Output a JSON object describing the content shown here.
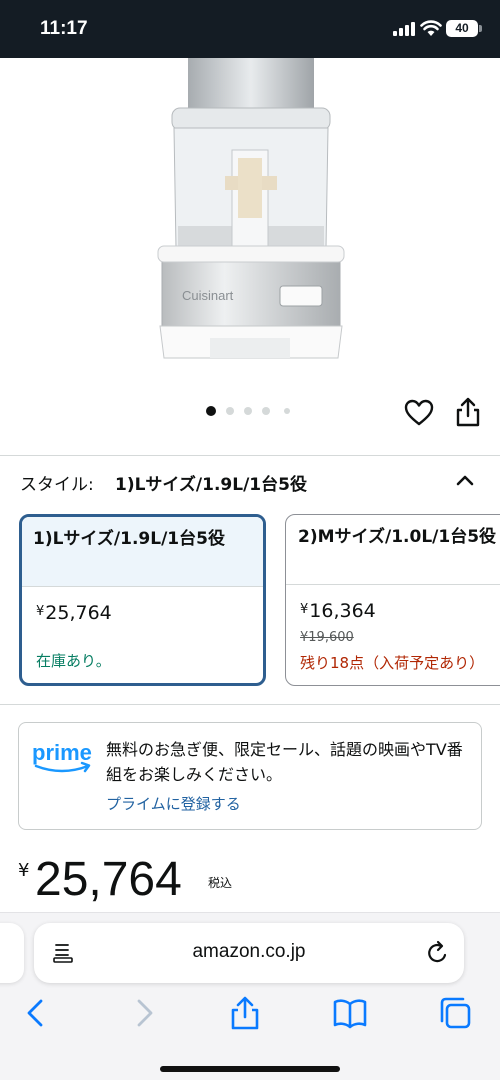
{
  "status_bar": {
    "time": "11:17",
    "battery": "40"
  },
  "product": {
    "image_brand": "Cuisinart",
    "image_caption": "FOOD PROCESSOR",
    "carousel_index": 1,
    "carousel_count": 5
  },
  "style_selector": {
    "label": "スタイル:",
    "selected": "1)Lサイズ/1.9L/1台5役",
    "options": [
      {
        "title": "1)Lサイズ/1.9L/1台5役",
        "currency": "¥",
        "price": "25,764",
        "strike_price": "",
        "stock": "在庫あり。",
        "stock_color": "#067d62",
        "selected": true
      },
      {
        "title": "2)Mサイズ/1.0L/1台5役",
        "currency": "¥",
        "price": "16,364",
        "strike_price": "¥19,600",
        "stock": "残り18点（入荷予定あり）",
        "stock_color": "#b12704",
        "selected": false
      }
    ]
  },
  "prime": {
    "logo_text": "prime",
    "message": "無料のお急ぎ便、限定セール、話題の映画やTV番組をお楽しみください。",
    "link": "プライムに登録する"
  },
  "price": {
    "currency": "¥",
    "amount": "25,764",
    "tax": "税込"
  },
  "browser": {
    "url": "amazon.co.jp"
  },
  "colors": {
    "selected_border": "#2e5e8f",
    "link": "#2162a1",
    "in_stock": "#067d62",
    "low_stock": "#b12704",
    "prime_blue": "#1a98ff"
  },
  "icons": [
    "heart-icon",
    "share-icon",
    "chevron-up-icon",
    "reader-icon",
    "reload-icon",
    "back-icon",
    "forward-icon",
    "bookmarks-icon",
    "tabs-icon"
  ]
}
